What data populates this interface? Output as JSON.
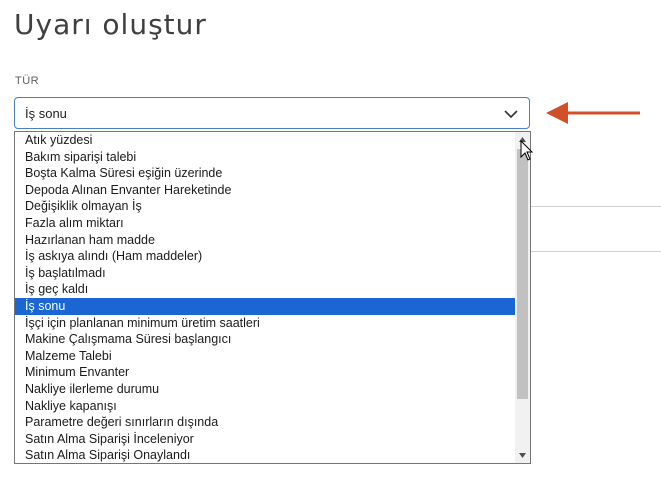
{
  "page": {
    "title": "Uyarı oluştur"
  },
  "form": {
    "type_label": "TÜR",
    "type_value": "İş sonu"
  },
  "dropdown": {
    "options": [
      "Atık yüzdesi",
      "Bakım siparişi talebi",
      "Boşta Kalma Süresi eşiğin üzerinde",
      "Depoda Alınan Envanter Hareketinde",
      "Değişiklik olmayan İş",
      "Fazla alım miktarı",
      "Hazırlanan ham madde",
      "İş askıya alındı (Ham maddeler)",
      "İş başlatılmadı",
      "İş geç kaldı",
      "İş sonu",
      "İşçi için planlanan minimum üretim saatleri",
      "Makine Çalışmama Süresi başlangıcı",
      "Malzeme Talebi",
      "Minimum Envanter",
      "Nakliye ilerleme durumu",
      "Nakliye kapanışı",
      "Parametre değeri sınırların dışında",
      "Satın Alma Siparişi İnceleniyor",
      "Satın Alma Siparişi Onaylandı"
    ],
    "selected_index": 10
  },
  "colors": {
    "accent": "#1a66d2",
    "arrow": "#d0502a",
    "border": "#4a7fc1"
  }
}
